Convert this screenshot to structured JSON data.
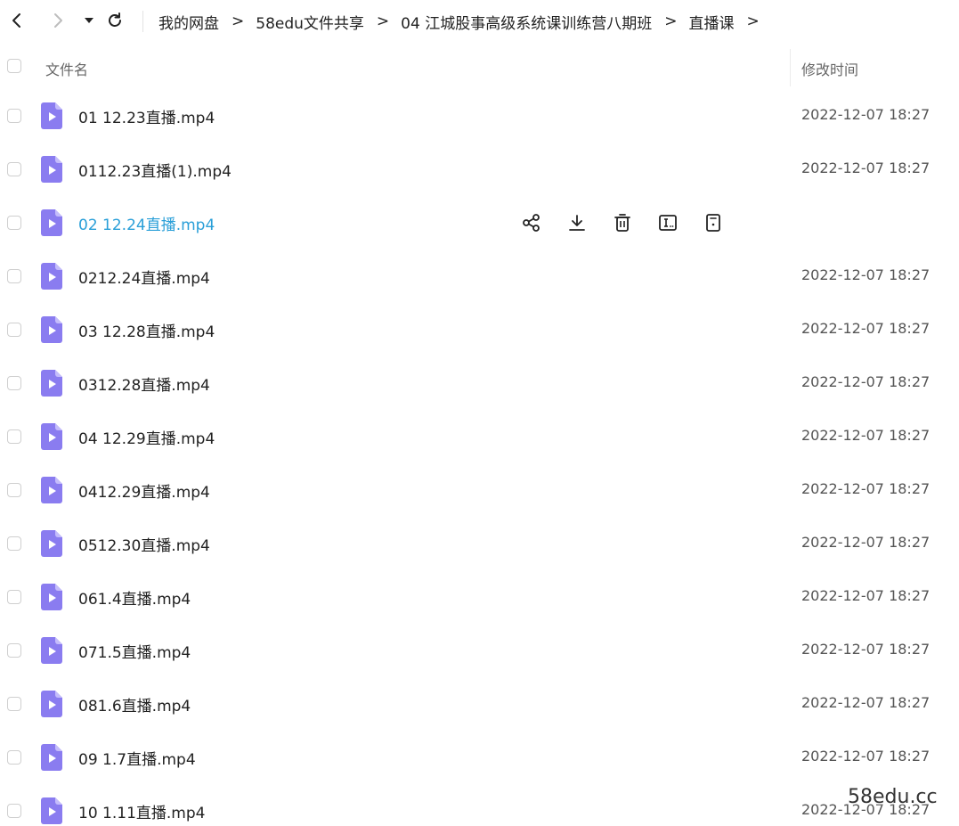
{
  "nav": {
    "back_icon": "chevron-left-icon",
    "forward_icon": "chevron-right-icon",
    "history_icon": "caret-down-icon",
    "refresh_icon": "refresh-icon"
  },
  "breadcrumb": {
    "separator": ">",
    "items": [
      {
        "label": "我的网盘"
      },
      {
        "label": "58edu文件共享"
      },
      {
        "label": "04 江城股事高级系统课训练营八期班"
      },
      {
        "label": "直播课"
      }
    ]
  },
  "table": {
    "headers": {
      "name": "文件名",
      "time": "修改时间"
    },
    "rows": [
      {
        "name": "01 12.23直播.mp4",
        "time": "2022-12-07 18:27"
      },
      {
        "name": "0112.23直播(1).mp4",
        "time": "2022-12-07 18:27"
      },
      {
        "name": "02 12.24直播.mp4",
        "time": "",
        "hover": true
      },
      {
        "name": "0212.24直播.mp4",
        "time": "2022-12-07 18:27"
      },
      {
        "name": "03 12.28直播.mp4",
        "time": "2022-12-07 18:27"
      },
      {
        "name": "0312.28直播.mp4",
        "time": "2022-12-07 18:27"
      },
      {
        "name": "04 12.29直播.mp4",
        "time": "2022-12-07 18:27"
      },
      {
        "name": "0412.29直播.mp4",
        "time": "2022-12-07 18:27"
      },
      {
        "name": "0512.30直播.mp4",
        "time": "2022-12-07 18:27"
      },
      {
        "name": "061.4直播.mp4",
        "time": "2022-12-07 18:27"
      },
      {
        "name": "071.5直播.mp4",
        "time": "2022-12-07 18:27"
      },
      {
        "name": "081.6直播.mp4",
        "time": "2022-12-07 18:27"
      },
      {
        "name": "09 1.7直播.mp4",
        "time": "2022-12-07 18:27"
      },
      {
        "name": "10 1.11直播.mp4",
        "time": "2022-12-07 18:27"
      }
    ]
  },
  "row_actions": [
    "share-icon",
    "download-icon",
    "delete-icon",
    "rename-icon",
    "more-icon"
  ],
  "watermark": "58edu.cc",
  "colors": {
    "file_icon": "#8a7cf0",
    "hover_text": "#2a9fd8"
  }
}
